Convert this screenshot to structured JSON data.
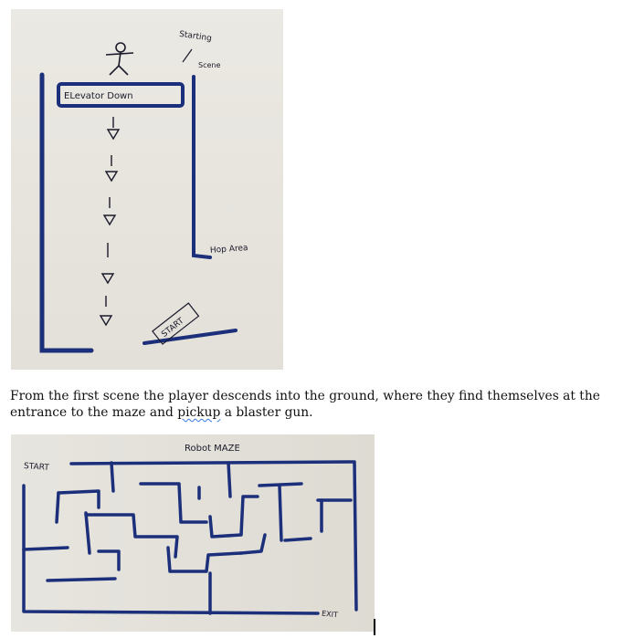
{
  "scene1": {
    "label_starting": "Starting",
    "label_scene": "Scene",
    "label_elevator": "ELevator Down",
    "label_hop_area": "Hop Area",
    "label_start": "START"
  },
  "caption": {
    "line1": "From the first scene the player descends into the ground, where they find themselves at the",
    "line2_before": "entrance to the maze and ",
    "line2_flagged": "pickup",
    "line2_after": " a blaster gun."
  },
  "scene2": {
    "label_title": "Robot MAZE",
    "label_start": "START",
    "label_exit": "EXIT"
  },
  "colors": {
    "ink": "#1c2f7a",
    "paper": "#e9e7e1"
  }
}
